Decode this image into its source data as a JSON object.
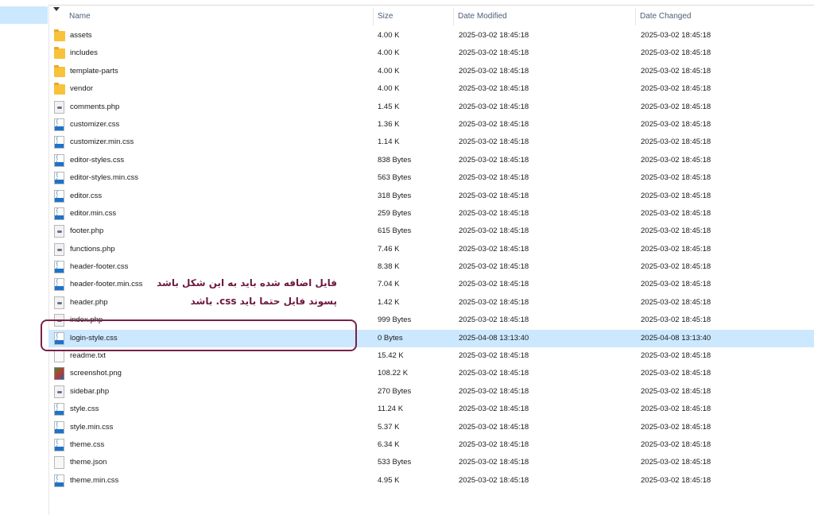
{
  "columns": {
    "name": "Name",
    "size": "Size",
    "date_modified": "Date Modified",
    "date_changed": "Date Changed"
  },
  "files": [
    {
      "name": "assets",
      "size": "4.00 K",
      "modified": "2025-03-02 18:45:18",
      "changed": "2025-03-02 18:45:18",
      "icon": "folder-icon",
      "type": "folder"
    },
    {
      "name": "includes",
      "size": "4.00 K",
      "modified": "2025-03-02 18:45:18",
      "changed": "2025-03-02 18:45:18",
      "icon": "folder-icon",
      "type": "folder"
    },
    {
      "name": "template-parts",
      "size": "4.00 K",
      "modified": "2025-03-02 18:45:18",
      "changed": "2025-03-02 18:45:18",
      "icon": "folder-icon",
      "type": "folder"
    },
    {
      "name": "vendor",
      "size": "4.00 K",
      "modified": "2025-03-02 18:45:18",
      "changed": "2025-03-02 18:45:18",
      "icon": "folder-icon",
      "type": "folder"
    },
    {
      "name": "comments.php",
      "size": "1.45 K",
      "modified": "2025-03-02 18:45:18",
      "changed": "2025-03-02 18:45:18",
      "icon": "php-file-icon",
      "type": "php"
    },
    {
      "name": "customizer.css",
      "size": "1.36 K",
      "modified": "2025-03-02 18:45:18",
      "changed": "2025-03-02 18:45:18",
      "icon": "css-file-icon",
      "type": "css"
    },
    {
      "name": "customizer.min.css",
      "size": "1.14 K",
      "modified": "2025-03-02 18:45:18",
      "changed": "2025-03-02 18:45:18",
      "icon": "css-file-icon",
      "type": "css"
    },
    {
      "name": "editor-styles.css",
      "size": "838 Bytes",
      "modified": "2025-03-02 18:45:18",
      "changed": "2025-03-02 18:45:18",
      "icon": "css-file-icon",
      "type": "css"
    },
    {
      "name": "editor-styles.min.css",
      "size": "563 Bytes",
      "modified": "2025-03-02 18:45:18",
      "changed": "2025-03-02 18:45:18",
      "icon": "css-file-icon",
      "type": "css"
    },
    {
      "name": "editor.css",
      "size": "318 Bytes",
      "modified": "2025-03-02 18:45:18",
      "changed": "2025-03-02 18:45:18",
      "icon": "css-file-icon",
      "type": "css"
    },
    {
      "name": "editor.min.css",
      "size": "259 Bytes",
      "modified": "2025-03-02 18:45:18",
      "changed": "2025-03-02 18:45:18",
      "icon": "css-file-icon",
      "type": "css"
    },
    {
      "name": "footer.php",
      "size": "615 Bytes",
      "modified": "2025-03-02 18:45:18",
      "changed": "2025-03-02 18:45:18",
      "icon": "php-file-icon",
      "type": "php"
    },
    {
      "name": "functions.php",
      "size": "7.46 K",
      "modified": "2025-03-02 18:45:18",
      "changed": "2025-03-02 18:45:18",
      "icon": "php-file-icon",
      "type": "php"
    },
    {
      "name": "header-footer.css",
      "size": "8.38 K",
      "modified": "2025-03-02 18:45:18",
      "changed": "2025-03-02 18:45:18",
      "icon": "css-file-icon",
      "type": "css"
    },
    {
      "name": "header-footer.min.css",
      "size": "7.04 K",
      "modified": "2025-03-02 18:45:18",
      "changed": "2025-03-02 18:45:18",
      "icon": "css-file-icon",
      "type": "css"
    },
    {
      "name": "header.php",
      "size": "1.42 K",
      "modified": "2025-03-02 18:45:18",
      "changed": "2025-03-02 18:45:18",
      "icon": "php-file-icon",
      "type": "php"
    },
    {
      "name": "index.php",
      "size": "999 Bytes",
      "modified": "2025-03-02 18:45:18",
      "changed": "2025-03-02 18:45:18",
      "icon": "php-file-icon",
      "type": "php"
    },
    {
      "name": "login-style.css",
      "size": "0 Bytes",
      "modified": "2025-04-08 13:13:40",
      "changed": "2025-04-08 13:13:40",
      "icon": "css-file-icon",
      "type": "css",
      "selected": true
    },
    {
      "name": "readme.txt",
      "size": "15.42 K",
      "modified": "2025-03-02 18:45:18",
      "changed": "2025-03-02 18:45:18",
      "icon": "text-file-icon",
      "type": "txt"
    },
    {
      "name": "screenshot.png",
      "size": "108.22 K",
      "modified": "2025-03-02 18:45:18",
      "changed": "2025-03-02 18:45:18",
      "icon": "image-file-icon",
      "type": "png"
    },
    {
      "name": "sidebar.php",
      "size": "270 Bytes",
      "modified": "2025-03-02 18:45:18",
      "changed": "2025-03-02 18:45:18",
      "icon": "php-file-icon",
      "type": "php"
    },
    {
      "name": "style.css",
      "size": "11.24 K",
      "modified": "2025-03-02 18:45:18",
      "changed": "2025-03-02 18:45:18",
      "icon": "css-file-icon",
      "type": "css"
    },
    {
      "name": "style.min.css",
      "size": "5.37 K",
      "modified": "2025-03-02 18:45:18",
      "changed": "2025-03-02 18:45:18",
      "icon": "css-file-icon",
      "type": "css"
    },
    {
      "name": "theme.css",
      "size": "6.34 K",
      "modified": "2025-03-02 18:45:18",
      "changed": "2025-03-02 18:45:18",
      "icon": "css-file-icon",
      "type": "css"
    },
    {
      "name": "theme.json",
      "size": "533 Bytes",
      "modified": "2025-03-02 18:45:18",
      "changed": "2025-03-02 18:45:18",
      "icon": "json-file-icon",
      "type": "json"
    },
    {
      "name": "theme.min.css",
      "size": "4.95 K",
      "modified": "2025-03-02 18:45:18",
      "changed": "2025-03-02 18:45:18",
      "icon": "css-file-icon",
      "type": "css"
    }
  ],
  "annotation": {
    "line1": "فایل اضافه شده باید به این شکل باشد",
    "line2": "پسوند فایل حتما باید css. باشد"
  },
  "colors": {
    "selection": "#cce8ff",
    "annotation": "#7a2049",
    "header_text": "#4c607a"
  }
}
